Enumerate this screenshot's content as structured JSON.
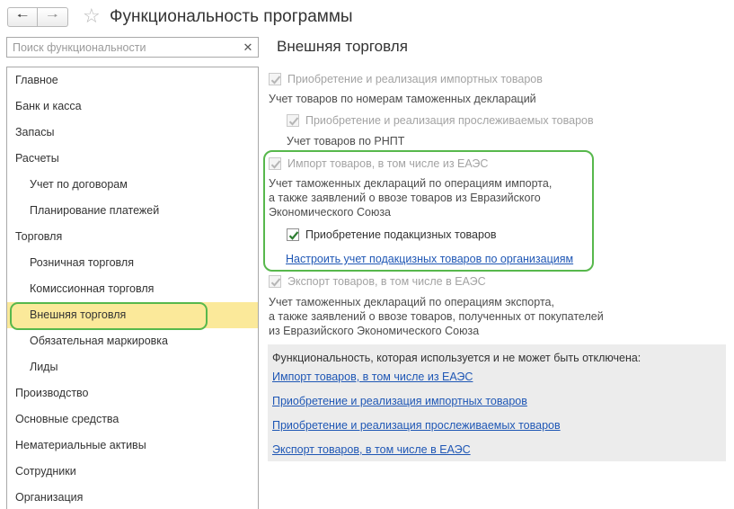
{
  "window": {
    "title": "Функциональность программы",
    "back_icon": "arrow-left-icon",
    "forward_icon": "arrow-right-icon",
    "favorite_icon": "star-icon"
  },
  "search": {
    "placeholder": "Поиск функциональности",
    "value": "",
    "clear_icon": "close-icon"
  },
  "sidebar": {
    "items": [
      {
        "label": "Главное",
        "level": 1
      },
      {
        "label": "Банк и касса",
        "level": 1
      },
      {
        "label": "Запасы",
        "level": 1
      },
      {
        "label": "Расчеты",
        "level": 1
      },
      {
        "label": "Учет по договорам",
        "level": 2
      },
      {
        "label": "Планирование платежей",
        "level": 2
      },
      {
        "label": "Торговля",
        "level": 1
      },
      {
        "label": "Розничная торговля",
        "level": 2
      },
      {
        "label": "Комиссионная торговля",
        "level": 2
      },
      {
        "label": "Внешняя торговля",
        "level": 2,
        "active": true
      },
      {
        "label": "Обязательная маркировка",
        "level": 2
      },
      {
        "label": "Лиды",
        "level": 2
      },
      {
        "label": "Производство",
        "level": 1
      },
      {
        "label": "Основные средства",
        "level": 1
      },
      {
        "label": "Нематериальные активы",
        "level": 1
      },
      {
        "label": "Сотрудники",
        "level": 1
      },
      {
        "label": "Организация",
        "level": 1
      }
    ]
  },
  "content": {
    "title": "Внешняя торговля",
    "import_goods": {
      "label": "Приобретение и реализация импортных товаров",
      "checked": true,
      "enabled": false,
      "description": "Учет товаров по номерам таможенных деклараций"
    },
    "traceable_goods": {
      "label": "Приобретение и реализация прослеживаемых товаров",
      "checked": true,
      "enabled": false,
      "description": "Учет товаров по РНПТ"
    },
    "import_eaeu": {
      "label": "Импорт товаров, в том числе из ЕАЭС",
      "checked": true,
      "enabled": false,
      "description_lines": [
        "Учет таможенных деклараций по операциям импорта,",
        "а также заявлений о ввозе товаров из Евразийского",
        "Экономического Союза"
      ]
    },
    "excise_goods": {
      "label": "Приобретение подакцизных товаров",
      "checked": true,
      "enabled": true
    },
    "excise_settings_link": "Настроить учет подакцизных товаров по организациям",
    "export_eaeu": {
      "label": "Экспорт товаров, в том числе в ЕАЭС",
      "checked": true,
      "enabled": false,
      "description_lines": [
        "Учет таможенных деклараций по операциям экспорта,",
        "а также заявлений о ввозе товаров, полученных от покупателей",
        "из Евразийского Экономического Союза"
      ]
    },
    "info": {
      "caption": "Функциональность, которая используется и не может быть отключена:",
      "links": [
        "Импорт товаров, в том числе из ЕАЭС",
        "Приобретение и реализация импортных товаров",
        "Приобретение и реализация прослеживаемых товаров",
        "Экспорт товаров, в том числе в ЕАЭС"
      ]
    }
  },
  "colors": {
    "highlight_green": "#57b84c",
    "active_item_bg": "#fbe99a",
    "link": "#1f57b5",
    "check_enabled": "#2e7d32",
    "check_disabled": "#b5b5b5"
  }
}
